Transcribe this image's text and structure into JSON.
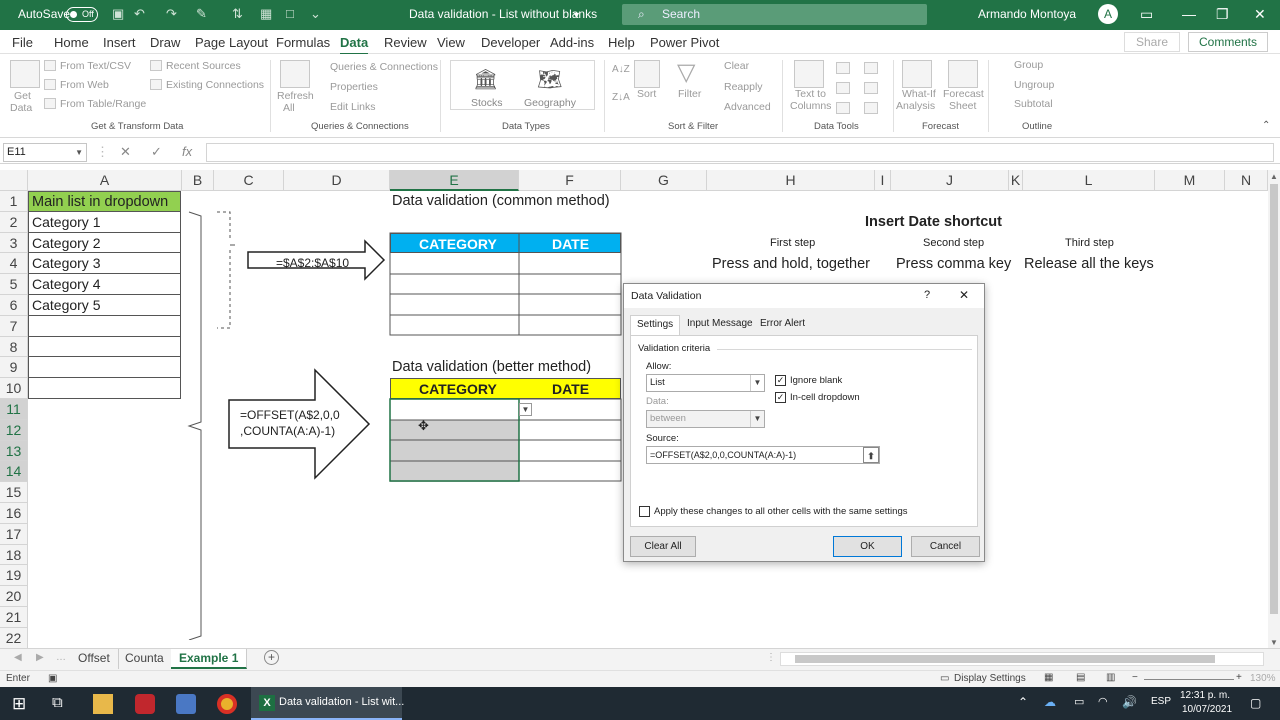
{
  "titlebar": {
    "autosave": "AutoSave",
    "autosave_state": "Off",
    "doc_title": "Data validation - List without blanks",
    "search": "Search",
    "user": "Armando Montoya",
    "user_initial": "A"
  },
  "menu": [
    "File",
    "Home",
    "Insert",
    "Draw",
    "Page Layout",
    "Formulas",
    "Data",
    "Review",
    "View",
    "Developer",
    "Add-ins",
    "Help",
    "Power Pivot"
  ],
  "share": "Share",
  "comments": "Comments",
  "ribbon": {
    "get_data": "Get",
    "get_data2": "Data",
    "from_text": "From Text/CSV",
    "from_web": "From Web",
    "from_table": "From Table/Range",
    "recent_sources": "Recent Sources",
    "existing_connections": "Existing Connections",
    "group_get": "Get & Transform Data",
    "refresh": "Refresh",
    "refresh2": "All",
    "queries": "Queries & Connections",
    "properties": "Properties",
    "edit_links": "Edit Links",
    "group_queries": "Queries & Connections",
    "stocks": "Stocks",
    "geography": "Geography",
    "group_datatypes": "Data Types",
    "sort_az": "A↓Z",
    "sort_za": "Z↓A",
    "sort": "Sort",
    "filter": "Filter",
    "clear": "Clear",
    "reapply": "Reapply",
    "advanced": "Advanced",
    "group_sort": "Sort & Filter",
    "text_to_columns": "Text to",
    "text_to_columns2": "Columns",
    "group_datatools": "Data Tools",
    "whatif": "What-If",
    "whatif2": "Analysis",
    "forecast_sheet": "Forecast",
    "forecast_sheet2": "Sheet",
    "group_forecast": "Forecast",
    "group_btn": "Group",
    "ungroup": "Ungroup",
    "subtotal": "Subtotal",
    "group_outline": "Outline"
  },
  "formula": {
    "namebox": "E11",
    "fx": "fx",
    "value": ""
  },
  "columns": [
    "A",
    "B",
    "C",
    "D",
    "E",
    "F",
    "G",
    "H",
    "I",
    "J",
    "K",
    "L",
    "M",
    "N"
  ],
  "rows": [
    "1",
    "2",
    "3",
    "4",
    "5",
    "6",
    "7",
    "8",
    "9",
    "10",
    "11",
    "12",
    "13",
    "14",
    "15",
    "16",
    "17",
    "18",
    "19",
    "20",
    "21",
    "22"
  ],
  "sheet": {
    "main_list_header": "Main list in dropdown",
    "categories": [
      "Category 1",
      "Category 2",
      "Category 3",
      "Category 4",
      "Category 5"
    ],
    "common_title": "Data validation (common method)",
    "better_title": "Data validation (better method)",
    "category_hdr": "CATEGORY",
    "date_hdr": "DATE",
    "arrow1_formula": "=$A$2:$A$10",
    "arrow2_formula": "=OFFSET(A$2,0,0\n,COUNTA(A:A)-1)",
    "shortcut_title": "Insert Date shortcut",
    "first_step": "First step",
    "second_step": "Second step",
    "third_step": "Third step",
    "first_desc": "Press and hold, together",
    "second_desc": "Press comma key",
    "third_desc": "Release all the keys"
  },
  "dialog": {
    "title": "Data Validation",
    "help": "?",
    "close": "✕",
    "tabs": [
      "Settings",
      "Input Message",
      "Error Alert"
    ],
    "criteria": "Validation criteria",
    "allow_label": "Allow:",
    "allow_value": "List",
    "ignore_blank": "Ignore blank",
    "incell": "In-cell dropdown",
    "data_label": "Data:",
    "data_value": "between",
    "source_label": "Source:",
    "source_value": "=OFFSET(A$2,0,0,COUNTA(A:A)-1)",
    "apply_all": "Apply these changes to all other cells with the same settings",
    "clear_all": "Clear All",
    "ok": "OK",
    "cancel": "Cancel"
  },
  "sheet_tabs": [
    "Offset",
    "Counta",
    "Example 1"
  ],
  "status": {
    "mode": "Enter",
    "display_settings": "Display Settings",
    "zoom": "130%"
  },
  "taskbar": {
    "app_label": "Data validation - List wit...",
    "lang": "ESP",
    "time": "12:31 p. m.",
    "date": "10/07/2021"
  }
}
